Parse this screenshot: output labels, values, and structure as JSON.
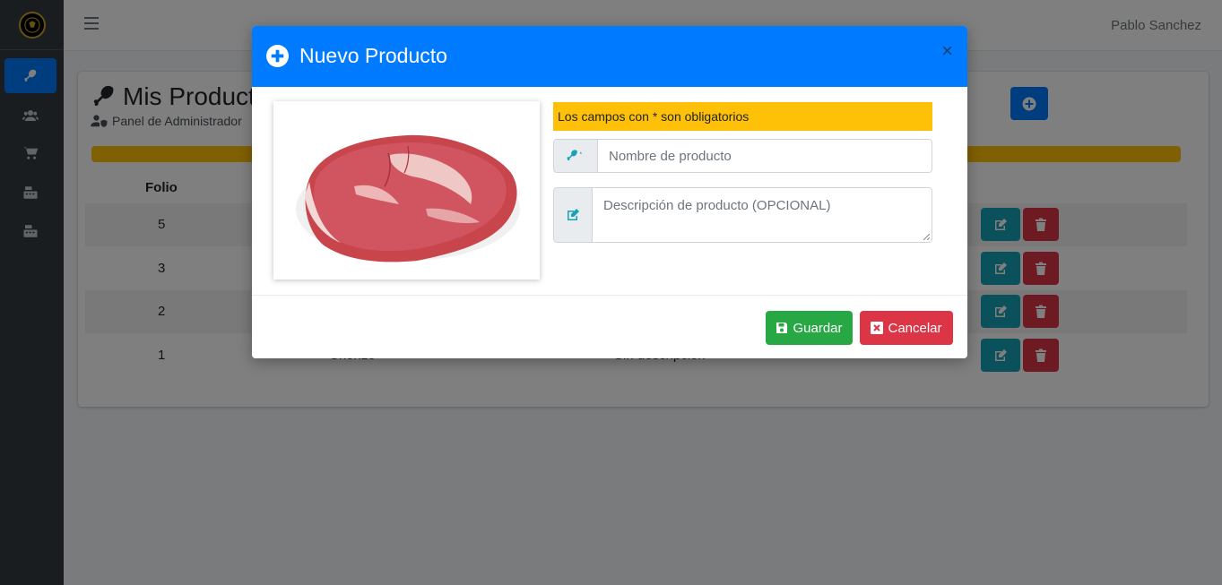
{
  "navbar": {
    "user_name": "Pablo Sanchez"
  },
  "sidebar": {
    "items": [
      {
        "icon": "drumstick-icon",
        "active": true
      },
      {
        "icon": "users-icon",
        "active": false
      },
      {
        "icon": "cart-icon",
        "active": false
      },
      {
        "icon": "cash-register-icon",
        "active": false
      },
      {
        "icon": "cash-register-icon",
        "active": false
      }
    ]
  },
  "page": {
    "title": "Mis Productos",
    "subtitle": "Panel de Administrador",
    "table": {
      "folio_header": "Folio",
      "rows": [
        {
          "folio": "5",
          "name": "",
          "description": ""
        },
        {
          "folio": "3",
          "name": "",
          "description": ""
        },
        {
          "folio": "2",
          "name": "",
          "description": ""
        },
        {
          "folio": "1",
          "name": "Chorizo",
          "description": "Sin descripción"
        }
      ]
    }
  },
  "modal": {
    "title": "Nuevo Producto",
    "close_label": "×",
    "notice": "Los campos con * son obligatorios",
    "name_placeholder": "Nombre de producto",
    "description_placeholder": "Descripción de producto (OPCIONAL)",
    "save_label": "Guardar",
    "cancel_label": "Cancelar"
  },
  "colors": {
    "primary": "#007bff",
    "warning": "#ffc107",
    "info": "#17a2b8",
    "success": "#28a745",
    "danger": "#dc3545",
    "sidebar": "#343a40"
  }
}
